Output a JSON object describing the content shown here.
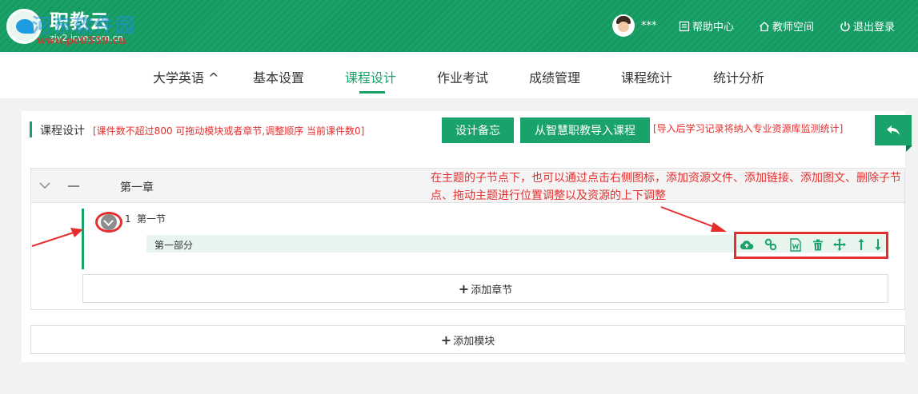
{
  "header": {
    "logo_title": "职教云",
    "logo_sub": "zjy2.icve.com.cn",
    "watermark": "www.pc0359.cn",
    "watermark2": "河东软件园",
    "user_name": "***",
    "help": "帮助中心",
    "teacher_space": "教师空间",
    "logout": "退出登录"
  },
  "nav": {
    "course": "大学英语 ^",
    "items": [
      "基本设置",
      "课程设计",
      "作业考试",
      "成绩管理",
      "课程统计",
      "统计分析"
    ],
    "active": "课程设计"
  },
  "design": {
    "title": "课程设计",
    "note": "[课件数不超过800 可拖动模块或者章节,调整顺序 当前课件数0]",
    "memo_button": "设计备忘",
    "import_button": "从智慧职教导入课程",
    "import_note": "[导入后学习记录将纳入专业资源库监测统计]"
  },
  "chapter": {
    "title": "第一章",
    "section_num": "1",
    "section_title": "第一节",
    "part_title": "第一部分"
  },
  "tools": [
    "cloud-upload-icon",
    "link-icon",
    "word-doc-icon",
    "trash-icon",
    "move-icon",
    "arrow-up-icon",
    "arrow-down-icon"
  ],
  "add_section": "添加章节",
  "add_module": "添加模块",
  "annotation": "在主题的子节点下，也可以通过点击右侧图标，添加资源文件、添加链接、添加图文、删除子节点、拖动主题进行位置调整以及资源的上下调整",
  "colors": {
    "brand": "#1aa26b",
    "annotation": "#e3302f"
  }
}
